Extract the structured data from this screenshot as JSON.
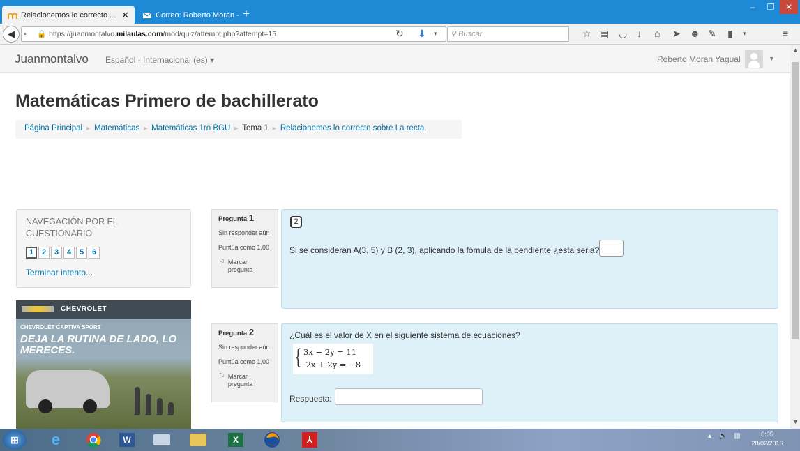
{
  "browser": {
    "tabs": [
      {
        "label": "Relacionemos lo correcto ...",
        "active": true
      },
      {
        "label": "Correo: Roberto Moran - ...",
        "active": false
      }
    ],
    "new_tab": "+",
    "url": {
      "prefix": "https://juanmontalvo.",
      "host": "milaulas.com",
      "path": "/mod/quiz/attempt.php?attempt=15"
    },
    "search_placeholder": "Buscar",
    "window_controls": [
      "minimize",
      "restore",
      "close"
    ]
  },
  "site": {
    "name": "Juanmontalvo",
    "language": "Español - Internacional (es) ▾",
    "user": "Roberto Moran Yagual"
  },
  "page": {
    "title": "Matemáticas Primero de bachillerato",
    "breadcrumb": [
      "Página Principal",
      "Matemáticas",
      "Matemáticas 1ro BGU",
      "Tema 1",
      "Relacionemos lo correcto sobre La recta."
    ]
  },
  "quiz_nav": {
    "title": "NAVEGACIÓN POR EL CUESTIONARIO",
    "buttons": [
      "1",
      "2",
      "3",
      "4",
      "5",
      "6"
    ],
    "finish": "Terminar intento..."
  },
  "ad": {
    "brand": "CHEVROLET",
    "model": "CHEVROLET CAPTIVA SPORT",
    "slogan": "DEJA LA RUTINA DE LADO, LO MERECES."
  },
  "questions": [
    {
      "label": "Pregunta",
      "number": "1",
      "state": "Sin responder aún",
      "grade": "Puntúa como 1,00",
      "flag": "Marcar pregunta",
      "image_number": "2",
      "text": "Si se consideran A(3, 5) y B (2, 3), aplicando la fómula de la pendiente ¿esta seria?",
      "answer_value": ""
    },
    {
      "label": "Pregunta",
      "number": "2",
      "state": "Sin responder aún",
      "grade": "Puntúa como 1,00",
      "flag": "Marcar pregunta",
      "text": "¿Cuál es el valor de X en el siguiente sistema de ecuaciones?",
      "equations": [
        "3x − 2y = 11",
        "−2x + 2y = −8"
      ],
      "answer_label": "Respuesta:",
      "answer_value": ""
    }
  ],
  "taskbar": {
    "apps": [
      "windows-start",
      "internet-explorer",
      "chrome",
      "word",
      "network-app",
      "file-explorer",
      "excel",
      "firefox",
      "acrobat"
    ],
    "clock": {
      "time": "0:05",
      "date": "20/02/2016"
    }
  },
  "colors": {
    "tabstrip": "#1e8ad6",
    "link": "#0070a8",
    "question_bg": "#def0f8"
  }
}
